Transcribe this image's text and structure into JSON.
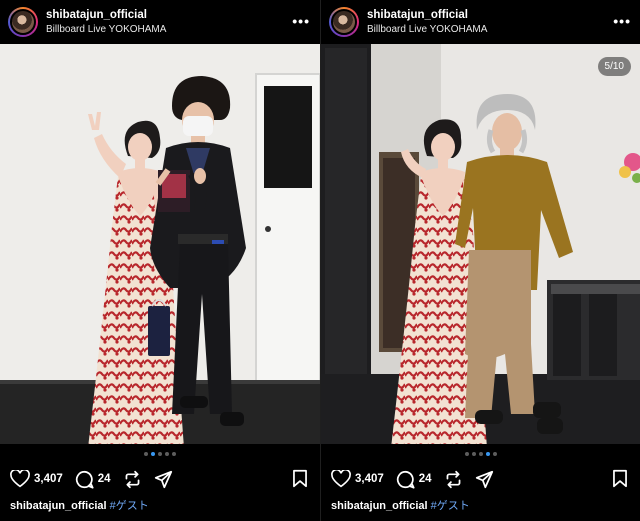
{
  "posts": [
    {
      "username": "shibatajun_official",
      "location": "Billboard Live YOKOHAMA",
      "more": "•••",
      "counter": "",
      "likes": "3,407",
      "comments": "24",
      "caption_user": "shibatajun_official",
      "caption_tag": "#ゲスト",
      "active_dot": 1,
      "dot_count": 5
    },
    {
      "username": "shibatajun_official",
      "location": "Billboard Live YOKOHAMA",
      "more": "•••",
      "counter": "5/10",
      "likes": "3,407",
      "comments": "24",
      "caption_user": "shibatajun_official",
      "caption_tag": "#ゲスト",
      "active_dot": 3,
      "dot_count": 5
    }
  ],
  "colors": {
    "background": "#000000",
    "link": "#6fa8f5",
    "active_dot": "#3897f0",
    "dress": "#b8272c"
  },
  "icons": [
    "heart-icon",
    "comment-icon",
    "repost-icon",
    "send-icon",
    "bookmark-icon",
    "more-icon"
  ]
}
